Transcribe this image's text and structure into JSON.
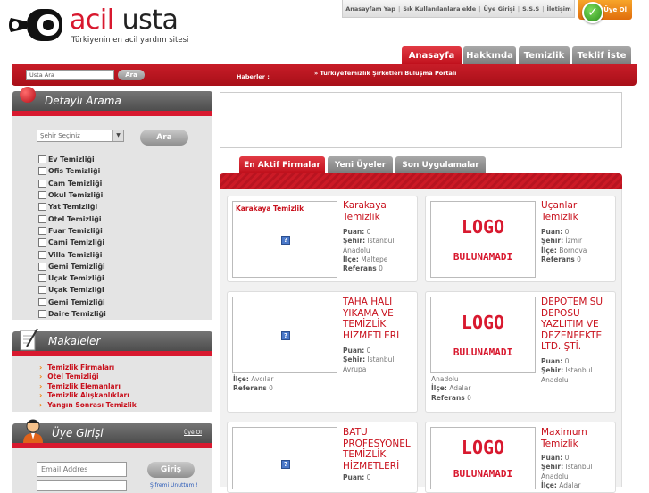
{
  "brand": {
    "title_acil": "acil",
    "title_usta": "usta",
    "subtitle": "Türkiyenin en acil yardım sitesi"
  },
  "toplinks": [
    "Anasayfam Yap",
    "Sık Kullanılanlara ekle",
    "Üye Girişi",
    "S.S.S",
    "İletişim"
  ],
  "uye_ol": "Üye Ol",
  "nav_tabs": [
    "Anasayfa",
    "Hakkında",
    "Temizlik",
    "Teklif İste"
  ],
  "search": {
    "placeholder": "Usta Ara",
    "button": "Ara"
  },
  "news": {
    "label": "Haberler :",
    "text": "» TürkiyeTemizlik Şirketleri Buluşma Portalı"
  },
  "detailed_search": {
    "title": "Detaylı Arama",
    "city_placeholder": "Şehir Seçiniz",
    "button": "Ara",
    "categories": [
      "Ev Temizliği",
      "Ofis Temizliği",
      "Cam Temizliği",
      "Okul Temizliği",
      "Yat Temizliği",
      "Otel Temizliği",
      "Fuar Temizliği",
      "Cami Temizliği",
      "Villa Temizliği",
      "Gemi Temizliği",
      "Uçak Temizliği",
      "Uçak Temizliği",
      "Gemi Temizliği",
      "Daire Temizliği"
    ]
  },
  "articles": {
    "title": "Makaleler",
    "items": [
      "Temizlik Firmaları",
      "Otel Temizliği",
      "Temizlik Elemanları",
      "Temizlik Alışkanlıkları",
      "Yangın Sonrası Temizlik"
    ]
  },
  "login": {
    "title": "Üye Girişi",
    "register_link": "Üye Ol",
    "email_placeholder": "Email Addres",
    "button": "Giriş",
    "forgot": "Şifremi Unuttum !"
  },
  "firm_tabs": [
    "En Aktif Firmalar",
    "Yeni Üyeler",
    "Son Uygulamalar"
  ],
  "logo_placeholder": {
    "line1": "LOGO",
    "line2": "BULUNAMADI"
  },
  "firms": [
    {
      "thumb_label": "Karakaya Temizlik",
      "name": "Karakaya Temizlik",
      "puan": "0",
      "sehir": "Istanbul Anadolu",
      "ilce": "Maltepe",
      "referans": "0"
    },
    {
      "name": "Uçanlar Temizlik",
      "puan": "0",
      "sehir": "İzmir",
      "ilce": "Bornova",
      "referans": "0"
    },
    {
      "name": "TAHA HALI YIKAMA VE TEMİZLİK HİZMETLERİ",
      "puan": "0",
      "sehir": "Istanbul Avrupa",
      "ilce": "Avcılar",
      "referans": "0"
    },
    {
      "name": "DEPOTEM SU DEPOSU YAZLITIM VE DEZENFEKTE LTD. ŞTİ.",
      "puan": "0",
      "sehir": "Istanbul Anadolu",
      "ilce": "Adalar",
      "referans": "0"
    },
    {
      "name": "BATU PROFESYONEL TEMİZLİK HİZMETLERİ",
      "puan": "0"
    },
    {
      "name": "Maximum Temizlik",
      "puan": "0",
      "sehir": "Istanbul Anadolu",
      "ilce": "Adalar"
    }
  ],
  "labels": {
    "puan": "Puan:",
    "sehir": "Şehir:",
    "ilce": "İlçe:",
    "referans": "Referans"
  }
}
